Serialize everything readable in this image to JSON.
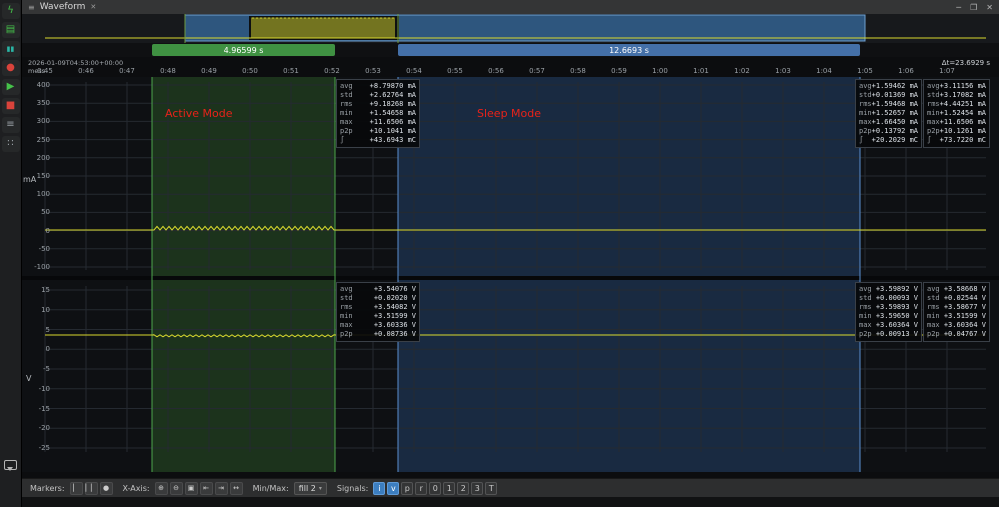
{
  "window": {
    "tab_title": "Waveform",
    "tab_close": "✕",
    "menu_glyph": "≡",
    "minimize": "─",
    "maximize": "❐",
    "close": "✕"
  },
  "colors": {
    "waveform": "#d9d92e",
    "grid": "#252a31",
    "plot_bg": "#0e1013",
    "view_box_fill": "rgba(51,98,143,0.85)",
    "view_box_edge": "#6fa0cf",
    "region_active_fill": "rgba(47,99,40,0.42)",
    "region_active_edge": "#4da64d",
    "region_sleep_fill": "rgba(38,72,118,0.48)",
    "region_sleep_edge": "#5a8fd0",
    "marker_active": "#3f9142",
    "marker_sleep": "#4470a8",
    "annotation": "#e8231a"
  },
  "sidebar": {
    "icons": [
      {
        "name": "power-icon",
        "glyph": "ϟ",
        "color": "#46c24a"
      },
      {
        "name": "open-file-icon",
        "glyph": "▤",
        "color": "#46c24a"
      },
      {
        "name": "pause-icon",
        "glyph": "▮▮",
        "color": "#2ab5a5"
      },
      {
        "name": "record-icon",
        "glyph": "●",
        "color": "#d9433b"
      },
      {
        "name": "play-icon",
        "glyph": "▶",
        "color": "#46c24a"
      },
      {
        "name": "stop-icon",
        "glyph": "■",
        "color": "#d9433b"
      },
      {
        "name": "device-icon",
        "glyph": "≡",
        "color": "#9aa0a6"
      },
      {
        "name": "widgets-icon",
        "glyph": "∷",
        "color": "#9aa0a6"
      }
    ]
  },
  "markers": {
    "active": {
      "label": "4.96599 s"
    },
    "sleep": {
      "label": "12.6693 s"
    }
  },
  "time_axis": {
    "start_label": "2026-01-09T04:53:00+00:00",
    "sub_label": "mess",
    "ticks": [
      "0:45",
      "0:46",
      "0:47",
      "0:48",
      "0:49",
      "0:50",
      "0:51",
      "0:52",
      "0:53",
      "0:54",
      "0:55",
      "0:56",
      "0:57",
      "0:58",
      "0:59",
      "1:00",
      "1:01",
      "1:02",
      "1:03",
      "1:04",
      "1:05",
      "1:06",
      "1:07"
    ],
    "delta_label": "Δt=23.6929 s"
  },
  "current_plot": {
    "unit": "mA",
    "yticks": [
      400,
      350,
      300,
      250,
      200,
      150,
      100,
      50,
      0,
      -50,
      -100
    ],
    "stats_dual": [
      [
        "avg",
        "+8.79870 mA"
      ],
      [
        "std",
        "+2.62764 mA"
      ],
      [
        "rms",
        "+9.18268 mA"
      ],
      [
        "min",
        "+1.54658 mA"
      ],
      [
        "max",
        "+11.6506 mA"
      ],
      [
        "p2p",
        "+10.1041 mA"
      ],
      [
        "∫",
        "+43.6943 mC"
      ]
    ],
    "stats_sleep": [
      [
        "avg",
        "+1.59462 mA"
      ],
      [
        "std",
        "+0.01369 mA"
      ],
      [
        "rms",
        "+1.59468 mA"
      ],
      [
        "min",
        "+1.52657 mA"
      ],
      [
        "max",
        "+1.66450 mA"
      ],
      [
        "p2p",
        "+0.13792 mA"
      ],
      [
        "∫",
        "+20.2029 mC"
      ]
    ],
    "stats_total": [
      [
        "avg",
        "+3.11156 mA"
      ],
      [
        "std",
        "+3.17082 mA"
      ],
      [
        "rms",
        "+4.44251 mA"
      ],
      [
        "min",
        "+1.52454 mA"
      ],
      [
        "max",
        "+11.6506 mA"
      ],
      [
        "p2p",
        "+10.1261 mA"
      ],
      [
        "∫",
        "+73.7220 mC"
      ]
    ]
  },
  "voltage_plot": {
    "unit": "V",
    "yticks": [
      15,
      10,
      5,
      0,
      -5,
      -10,
      -15,
      -20,
      -25
    ],
    "stats_dual": [
      [
        "avg",
        "+3.54076 V"
      ],
      [
        "std",
        "+0.02020 V"
      ],
      [
        "rms",
        "+3.54082 V"
      ],
      [
        "min",
        "+3.51599 V"
      ],
      [
        "max",
        "+3.60336 V"
      ],
      [
        "p2p",
        "+0.08736 V"
      ]
    ],
    "stats_sleep": [
      [
        "avg",
        "+3.59892 V"
      ],
      [
        "std",
        "+0.00093 V"
      ],
      [
        "rms",
        "+3.59893 V"
      ],
      [
        "min",
        "+3.59650 V"
      ],
      [
        "max",
        "+3.60364 V"
      ],
      [
        "p2p",
        "+0.00913 V"
      ]
    ],
    "stats_total": [
      [
        "avg",
        "+3.58668 V"
      ],
      [
        "std",
        "+0.02544 V"
      ],
      [
        "rms",
        "+3.58677 V"
      ],
      [
        "min",
        "+3.51599 V"
      ],
      [
        "max",
        "+3.60364 V"
      ],
      [
        "p2p",
        "+0.04767 V"
      ]
    ]
  },
  "annotations": {
    "active": "Active Mode",
    "sleep": "Sleep Mode"
  },
  "signals": {
    "current": {
      "idle_mA": 1.6,
      "active_min_mA": 1.54658,
      "active_max_mA": 11.6506,
      "sleep_mA": 1.59462
    },
    "voltage": {
      "active_avg_V": 3.54076,
      "sleep_V": 3.59892
    }
  },
  "toolbar": {
    "markers_label": "Markers:",
    "marker_tools": [
      {
        "name": "marker-single-icon",
        "glyph": "▏"
      },
      {
        "name": "marker-dual-icon",
        "glyph": "▏▏"
      },
      {
        "name": "marker-clear-icon",
        "glyph": "●"
      }
    ],
    "xaxis_label": "X-Axis:",
    "xaxis_tools": [
      {
        "name": "zoom-in-icon",
        "glyph": "⊕"
      },
      {
        "name": "zoom-out-icon",
        "glyph": "⊖"
      },
      {
        "name": "zoom-window-icon",
        "glyph": "▣"
      },
      {
        "name": "pan-left-icon",
        "glyph": "⇤"
      },
      {
        "name": "pan-right-icon",
        "glyph": "⇥"
      },
      {
        "name": "zoom-all-icon",
        "glyph": "↔"
      }
    ],
    "minmax_label": "Min/Max:",
    "minmax_value": "fill 2",
    "caret": "▾",
    "signals_label": "Signals:",
    "signal_buttons": [
      {
        "label": "i",
        "active": true
      },
      {
        "label": "v",
        "active": true
      },
      {
        "label": "p",
        "active": false
      },
      {
        "label": "r",
        "active": false
      },
      {
        "label": "0",
        "active": false
      },
      {
        "label": "1",
        "active": false
      },
      {
        "label": "2",
        "active": false
      },
      {
        "label": "3",
        "active": false
      },
      {
        "label": "T",
        "active": false
      }
    ]
  }
}
